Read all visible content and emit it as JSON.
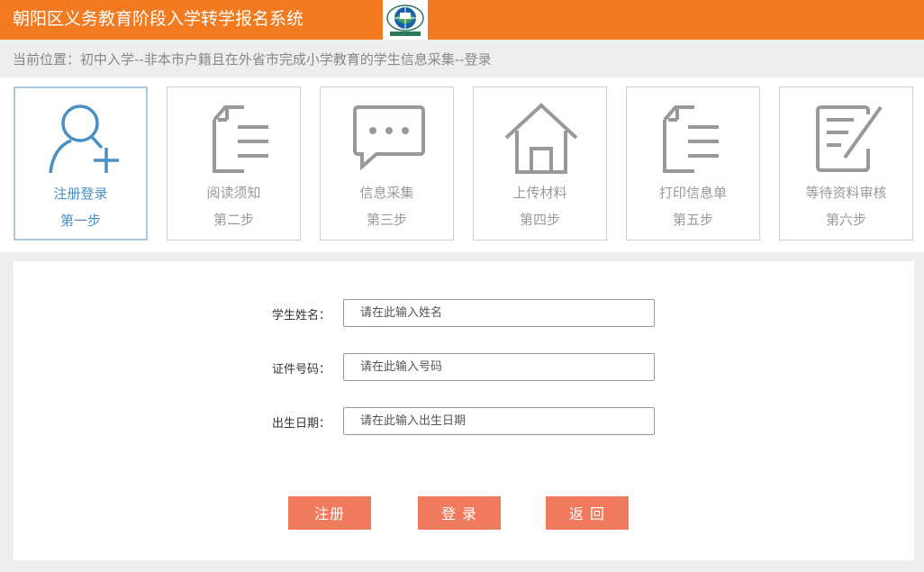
{
  "header": {
    "title": "朝阳区义务教育阶段入学转学报名系统",
    "logo_icon": "education-globe-logo-icon"
  },
  "breadcrumb": {
    "text": "当前位置：初中入学--非本市户籍且在外省市完成小学教育的学生信息采集--登录"
  },
  "steps": [
    {
      "label": "注册登录",
      "num": "第一步",
      "icon": "user-add-icon",
      "active": true
    },
    {
      "label": "阅读须知",
      "num": "第二步",
      "icon": "document-icon",
      "active": false
    },
    {
      "label": "信息采集",
      "num": "第三步",
      "icon": "chat-bubble-icon",
      "active": false
    },
    {
      "label": "上传材料",
      "num": "第四步",
      "icon": "home-icon",
      "active": false
    },
    {
      "label": "打印信息单",
      "num": "第五步",
      "icon": "document-icon",
      "active": false
    },
    {
      "label": "等待资料审核",
      "num": "第六步",
      "icon": "edit-note-icon",
      "active": false
    }
  ],
  "form": {
    "name": {
      "label": "学生姓名：",
      "placeholder": "请在此输入姓名",
      "value": ""
    },
    "id_number": {
      "label": "证件号码：",
      "placeholder": "请在此输入号码",
      "value": ""
    },
    "birth_date": {
      "label": "出生日期：",
      "placeholder": "请在此输入出生日期",
      "value": ""
    }
  },
  "buttons": {
    "register": "注册",
    "login": "登 录",
    "back": "返 回"
  },
  "colors": {
    "header": "#f47a20",
    "button": "#ef7a5e",
    "active_step": "#4a8fc4",
    "inactive_step": "#999999"
  }
}
